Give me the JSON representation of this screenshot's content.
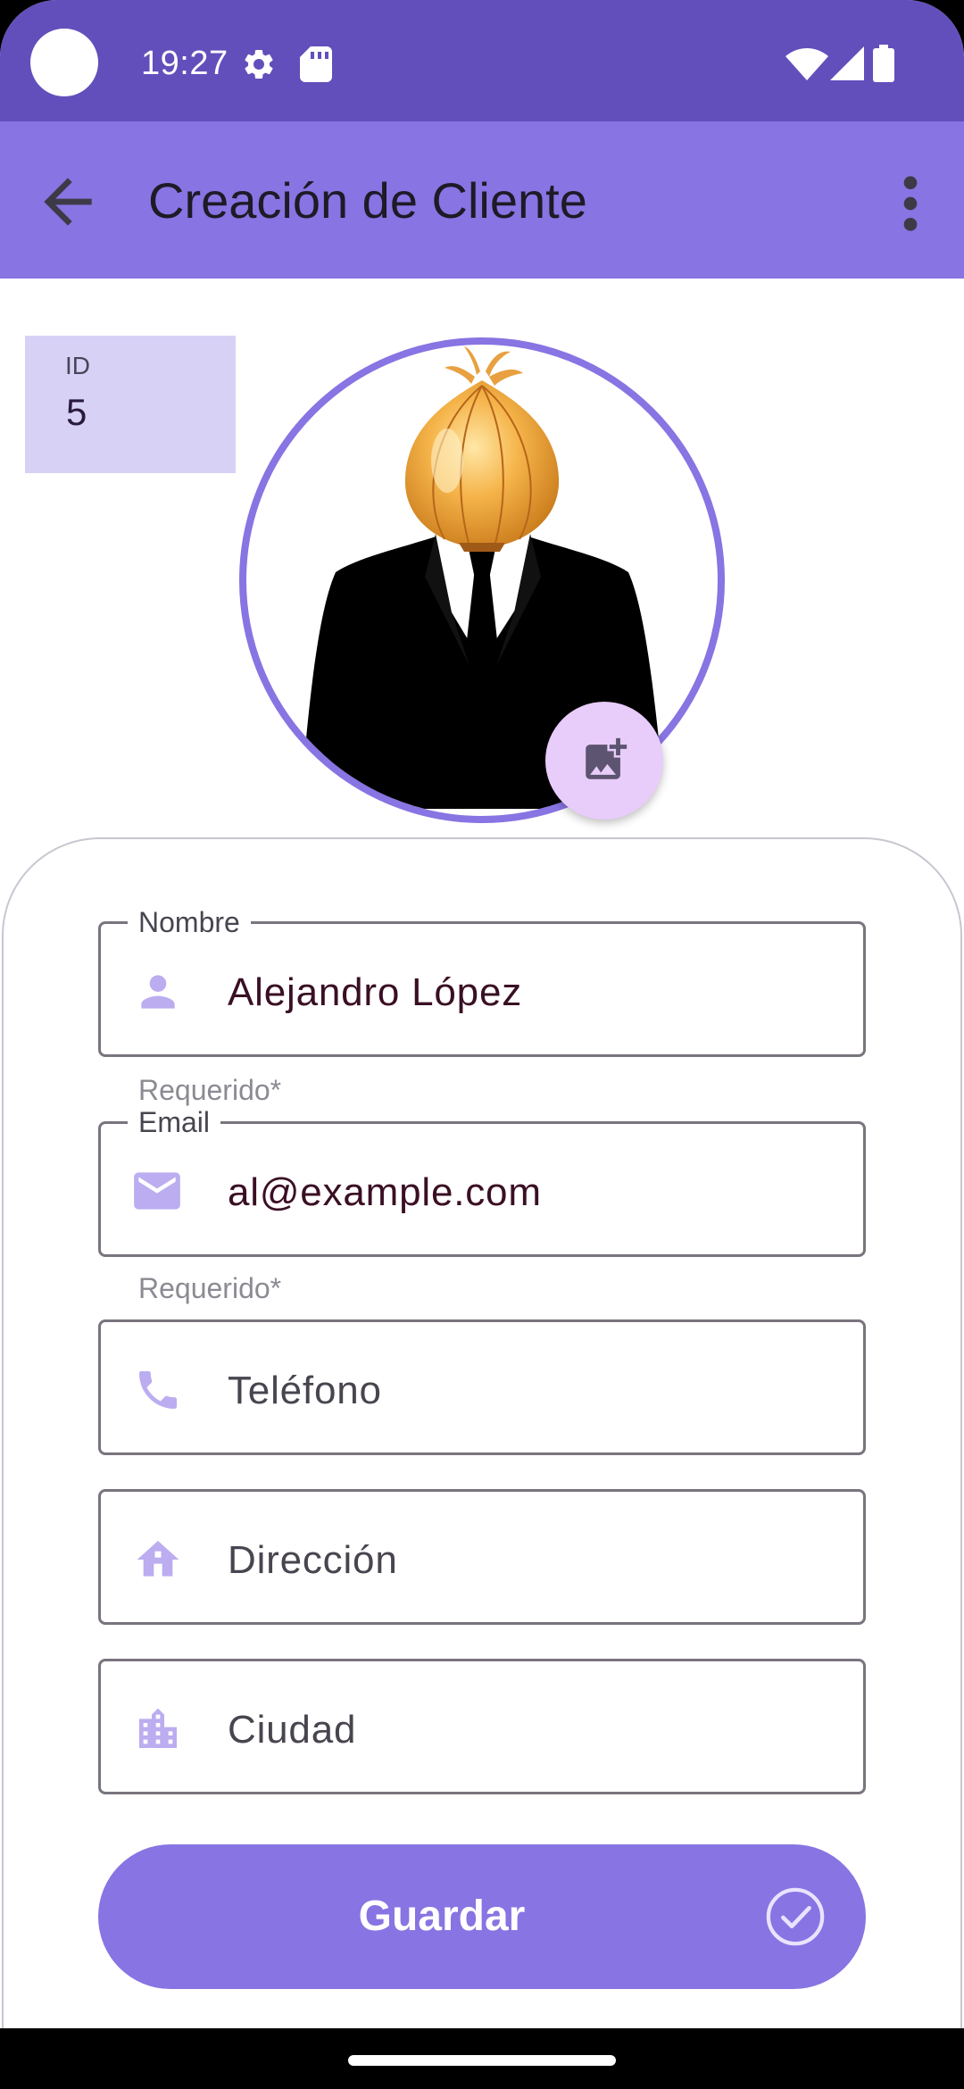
{
  "status_bar": {
    "time": "19:27",
    "icons": [
      "settings-gear-icon",
      "sd-card-icon",
      "wifi-icon",
      "signal-icon",
      "battery-icon"
    ]
  },
  "app_bar": {
    "title": "Creación de Cliente",
    "back_icon": "arrow-back-icon",
    "menu_icon": "more-vert-icon"
  },
  "id_field": {
    "label": "ID",
    "value": "5"
  },
  "avatar": {
    "description_icon": "avatar-onion-suit",
    "add_photo_icon": "add-photo-icon"
  },
  "form": {
    "nombre": {
      "label": "Nombre",
      "value": "Alejandro López",
      "helper": "Requerido*",
      "icon": "person-icon"
    },
    "email": {
      "label": "Email",
      "value": "al@example.com",
      "helper": "Requerido*",
      "icon": "mail-icon"
    },
    "telefono": {
      "placeholder": "Teléfono",
      "icon": "phone-icon"
    },
    "direccion": {
      "placeholder": "Dirección",
      "icon": "home-icon"
    },
    "ciudad": {
      "placeholder": "Ciudad",
      "icon": "city-icon"
    }
  },
  "save_button": {
    "label": "Guardar",
    "icon": "check-circle-icon"
  },
  "colors": {
    "status_bar": "#634FBB",
    "app_bar": "#8874E2",
    "accent": "#8874E2",
    "id_bg": "#D8D1F6",
    "icon_tint": "#BBADF0",
    "fab_bg": "#E8CCFA"
  }
}
